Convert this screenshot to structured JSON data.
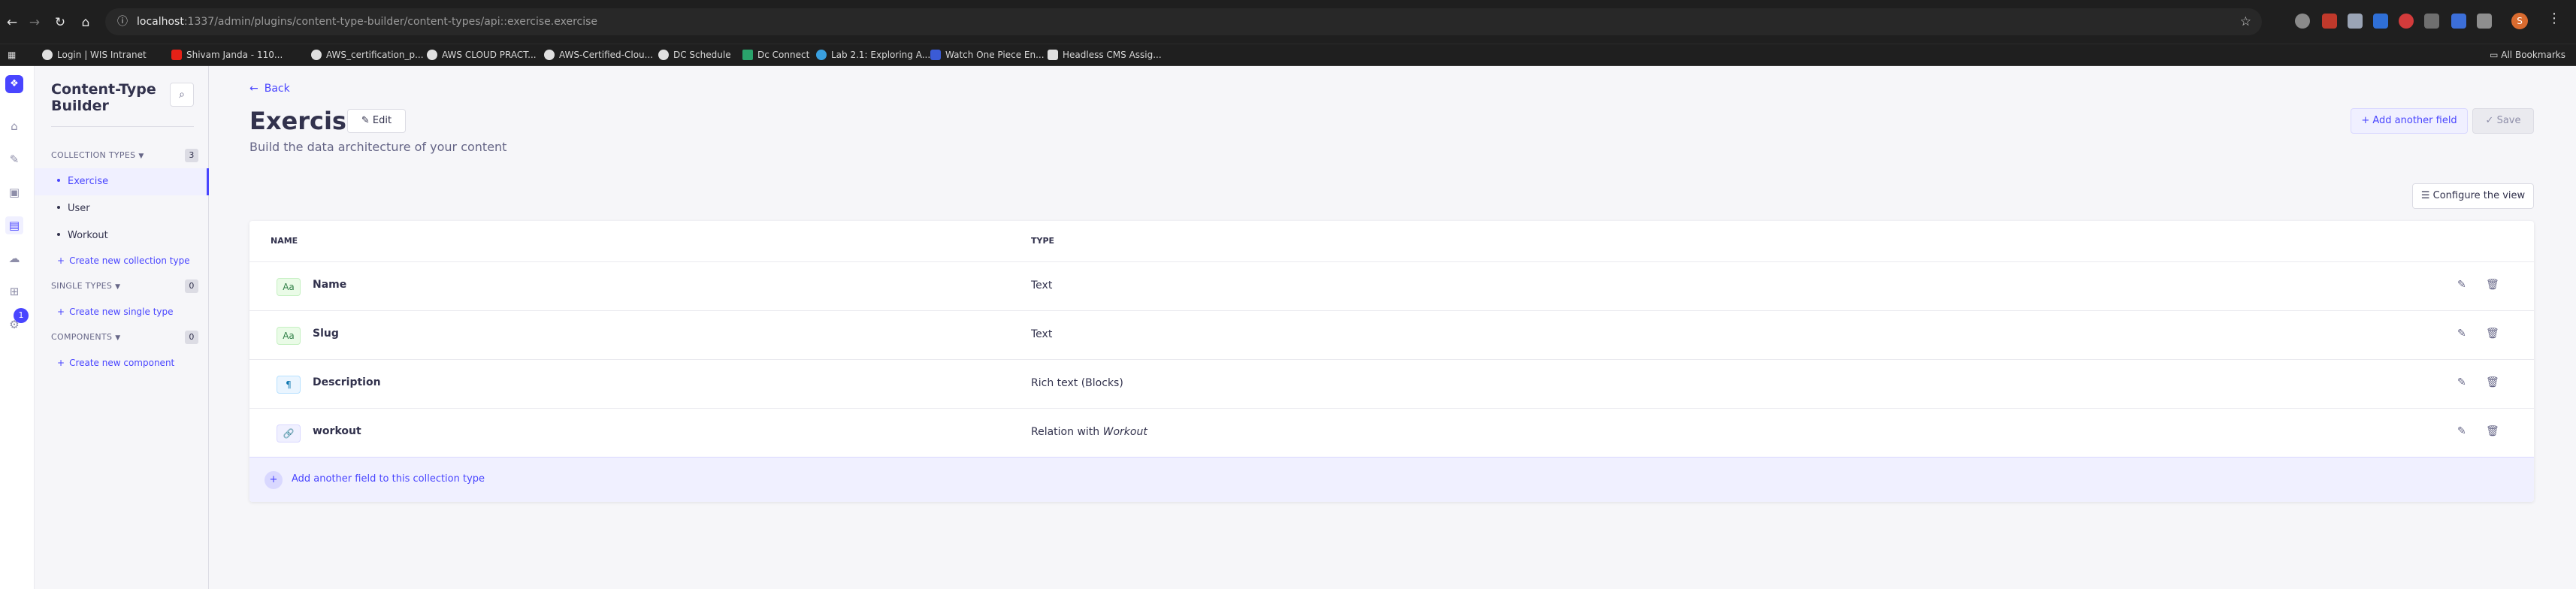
{
  "browser": {
    "nav": {
      "back": "←",
      "forward": "→",
      "reload": "↻",
      "home": "⌂"
    },
    "url_host": "localhost",
    "url_path": ":1337/admin/plugins/content-type-builder/content-types/api::exercise.exercise",
    "profile_initial": "S",
    "bookmarks": [
      "Login | WIS Intranet",
      "Shivam Janda - 110...",
      "AWS_certification_p...",
      "AWS CLOUD PRACT...",
      "AWS-Certified-Clou...",
      "DC  Schedule",
      "Dc Connect",
      "Lab 2.1: Exploring A...",
      "Watch One Piece En...",
      "Headless CMS Assig..."
    ],
    "all_bookmarks": "All Bookmarks"
  },
  "main_nav": {
    "badge_count": "1"
  },
  "subnav": {
    "title": "Content-Type Builder",
    "sections": {
      "collection": {
        "label": "COLLECTION TYPES",
        "count": "3"
      },
      "single": {
        "label": "SINGLE TYPES",
        "count": "0"
      },
      "components": {
        "label": "COMPONENTS",
        "count": "0"
      }
    },
    "collection_items": [
      "Exercise",
      "User",
      "Workout"
    ],
    "create_collection": "Create new collection type",
    "create_single": "Create new single type",
    "create_component": "Create new component"
  },
  "header": {
    "back": "Back",
    "title": "Exercise",
    "edit": "Edit",
    "subtitle": "Build the data architecture of your content",
    "add_field": "Add another field",
    "save": "Save",
    "configure_view": "Configure the view"
  },
  "table": {
    "col_name": "NAME",
    "col_type": "TYPE",
    "rows": [
      {
        "icon": "Aa",
        "name": "Name",
        "type": "Text"
      },
      {
        "icon": "Aa",
        "name": "Slug",
        "type": "Text"
      },
      {
        "icon": "¶",
        "name": "Description",
        "type": "Rich text (Blocks)"
      },
      {
        "icon": "🔗",
        "name": "workout",
        "type_prefix": "Relation with ",
        "type_target": "Workout"
      }
    ],
    "add_row": "Add another field to this collection type"
  },
  "colors": {
    "primary": "#4945ff",
    "neutral_bg": "#f6f6f9"
  }
}
